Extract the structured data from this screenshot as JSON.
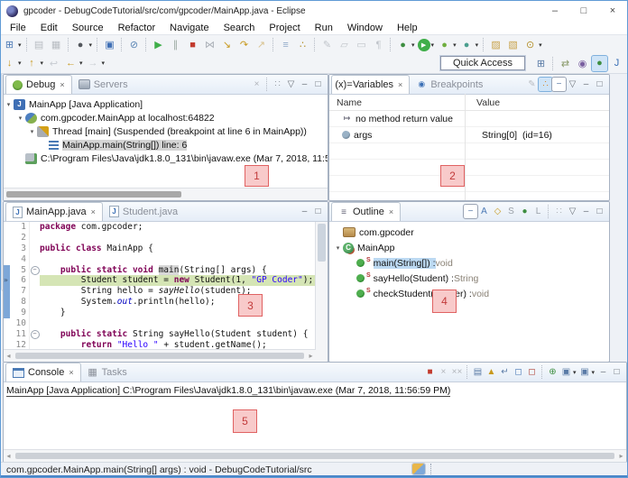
{
  "window": {
    "title": "gpcoder - DebugCodeTutorial/src/com/gpcoder/MainApp.java - Eclipse",
    "controls": {
      "minimize": "–",
      "maximize": "□",
      "close": "×"
    }
  },
  "menu": {
    "items": [
      "File",
      "Edit",
      "Source",
      "Refactor",
      "Navigate",
      "Search",
      "Project",
      "Run",
      "Window",
      "Help"
    ]
  },
  "toolbar": {
    "quick_access": "Quick Access",
    "row1": [
      {
        "n": "new-wizard-icon",
        "g": "⊞",
        "c": "#4a78b5",
        "dd": true
      },
      {
        "sep": true
      },
      {
        "n": "save-icon",
        "g": "▤",
        "c": "#b8bcc2"
      },
      {
        "n": "save-all-icon",
        "g": "▦",
        "c": "#b8bcc2"
      },
      {
        "sep": true
      },
      {
        "n": "user-profile-icon",
        "g": "●",
        "c": "#52565c",
        "dd": true
      },
      {
        "sep": true
      },
      {
        "n": "open-console-view-icon",
        "g": "▣",
        "c": "#3f6fb5"
      },
      {
        "sep": true
      },
      {
        "n": "skip-all-breakpoints-icon",
        "g": "⊘",
        "c": "#5b86b5"
      },
      {
        "sep": true
      },
      {
        "n": "resume-icon",
        "g": "▶",
        "c": "#3fae49"
      },
      {
        "n": "suspend-icon",
        "g": "∥",
        "c": "#9aa8a0"
      },
      {
        "n": "terminate-icon",
        "g": "■",
        "c": "#c23b2e"
      },
      {
        "n": "disconnect-icon",
        "g": "⋈",
        "c": "#a8adb5"
      },
      {
        "n": "step-into-icon",
        "g": "↘",
        "c": "#c8991e"
      },
      {
        "n": "step-over-icon",
        "g": "↷",
        "c": "#c8991e"
      },
      {
        "n": "step-return-icon",
        "g": "↗",
        "c": "#d8c28e"
      },
      {
        "sep": true
      },
      {
        "n": "drop-to-frame-icon",
        "g": "≡",
        "c": "#8fa8c8"
      },
      {
        "n": "use-step-filters-icon",
        "g": "∴",
        "c": "#b5912e"
      },
      {
        "sep": true
      },
      {
        "n": "mark-occurrences-icon",
        "g": "✎",
        "c": "#c0c4ca"
      },
      {
        "n": "show-source-icon",
        "g": "▱",
        "c": "#c0c4ca"
      },
      {
        "n": "show-annotations-icon",
        "g": "▭",
        "c": "#c0c4ca"
      },
      {
        "n": "show-whitespace-icon",
        "g": "¶",
        "c": "#c0c4ca"
      },
      {
        "sep": true
      },
      {
        "n": "debug-icon",
        "g": "●",
        "c": "#3e8e41",
        "dd": true
      },
      {
        "n": "run-icon",
        "g": "▶",
        "c": "#ffffff",
        "bg": "#3fae49",
        "dd": true
      },
      {
        "n": "coverage-icon",
        "g": "●",
        "c": "#6fae3f",
        "dd": true
      },
      {
        "n": "profile-icon",
        "g": "●",
        "c": "#4a9e8e",
        "dd": true
      },
      {
        "sep": true
      },
      {
        "n": "open-type-icon",
        "g": "▨",
        "c": "#c8a24a"
      },
      {
        "n": "open-resource-icon",
        "g": "▧",
        "c": "#c8a24a"
      },
      {
        "n": "search-icon",
        "g": "⊙",
        "c": "#b5912e",
        "dd": true
      }
    ],
    "row2": [
      {
        "n": "next-annotation-icon",
        "g": "↓",
        "c": "#c8991e",
        "dd": true
      },
      {
        "n": "previous-annotation-icon",
        "g": "↑",
        "c": "#c8991e",
        "dd": true
      },
      {
        "n": "last-edit-location-icon",
        "g": "↩",
        "c": "#c8ccd2"
      },
      {
        "n": "back-icon",
        "g": "←",
        "c": "#c8991e",
        "dd": true
      },
      {
        "n": "forward-icon",
        "g": "→",
        "c": "#c8ccd2",
        "dd": true
      }
    ],
    "perspectives": [
      {
        "n": "open-perspective-icon",
        "g": "⊞",
        "c": "#5a7ba6"
      },
      {
        "sep": true
      },
      {
        "n": "team-sync-perspective-icon",
        "g": "⇄",
        "c": "#8a9a6a"
      },
      {
        "n": "java-ee-perspective-icon",
        "g": "◉",
        "c": "#7a5fa0"
      },
      {
        "n": "debug-perspective-icon",
        "g": "●",
        "c": "#3e8e41",
        "active": true
      },
      {
        "n": "java-perspective-icon",
        "g": "J",
        "c": "#3a6fb5"
      }
    ]
  },
  "debug_view": {
    "tabs": [
      {
        "label": "Debug",
        "icon": "bug",
        "ig": "",
        "name": "tab-debug",
        "selected": true,
        "close": true
      },
      {
        "label": "Servers",
        "icon": "server",
        "ig": "",
        "name": "tab-servers"
      }
    ],
    "toolbar": [
      {
        "n": "remove-all-terminated-icon",
        "g": "×",
        "c": "#b0b4ba"
      },
      {
        "sep": true
      },
      {
        "n": "view-options-icon",
        "g": "∷",
        "c": "#9aa0a8"
      },
      {
        "n": "view-menu-icon",
        "g": "▽",
        "c": "#6a7078"
      },
      {
        "n": "minimize-view-icon",
        "g": "–",
        "c": "#6a7078"
      },
      {
        "n": "maximize-view-icon",
        "g": "□",
        "c": "#6a7078"
      }
    ],
    "tree": [
      {
        "level": 0,
        "exp": true,
        "icon": "javaapp",
        "iglyph": "J",
        "text": "MainApp [Java Application]"
      },
      {
        "level": 1,
        "exp": true,
        "icon": "jvm",
        "iglyph": "",
        "text": "com.gpcoder.MainApp at localhost:64822"
      },
      {
        "level": 2,
        "exp": true,
        "icon": "thread",
        "iglyph": "",
        "text": "Thread [main] (Suspended (breakpoint at line 6 in MainApp))"
      },
      {
        "level": 3,
        "icon": "frame",
        "iglyph": "",
        "text": "MainApp.main(String[]) line: 6",
        "selected": true
      },
      {
        "level": 1,
        "icon": "process",
        "iglyph": "",
        "text": "C:\\Program Files\\Java\\jdk1.8.0_131\\bin\\javaw.exe (Mar 7, 2018, 11:56:59 PM)"
      }
    ]
  },
  "variables_view": {
    "tabs": [
      {
        "label": "Variables",
        "icon": "vars",
        "ig": "(x)=",
        "name": "tab-variables",
        "selected": true,
        "close": true
      },
      {
        "label": "Breakpoints",
        "icon": "bp",
        "ig": "◉",
        "name": "tab-breakpoints"
      }
    ],
    "toolbar": [
      {
        "n": "show-type-names-icon",
        "g": "✎",
        "c": "#b8bcc2"
      },
      {
        "n": "show-logical-structures-icon",
        "g": "∴",
        "c": "#d8862e",
        "active": true
      },
      {
        "n": "collapse-all-icon",
        "g": "−",
        "c": "#5a7ba6",
        "b": true
      },
      {
        "n": "view-menu-icon",
        "g": "▽",
        "c": "#6a7078"
      },
      {
        "n": "minimize-view-icon",
        "g": "–",
        "c": "#6a7078"
      },
      {
        "n": "maximize-view-icon",
        "g": "□",
        "c": "#6a7078"
      }
    ],
    "columns": [
      "Name",
      "Value"
    ],
    "rows": [
      {
        "icon": "ret",
        "iglyph": "↦",
        "name": "no method return value",
        "value": ""
      },
      {
        "icon": "var",
        "iglyph": "",
        "name": "args",
        "value": "String[0]  (id=16)"
      }
    ]
  },
  "editor": {
    "tabs": [
      {
        "label": "MainApp.java",
        "icon": "jfile",
        "ig": "J",
        "name": "tab-mainapp-java",
        "selected": true,
        "close": true
      },
      {
        "label": "Student.java",
        "icon": "jfile",
        "ig": "J",
        "name": "tab-student-java"
      }
    ],
    "toolbar": [
      {
        "n": "minimize-view-icon",
        "g": "–",
        "c": "#6a7078"
      },
      {
        "n": "maximize-view-icon",
        "g": "□",
        "c": "#6a7078"
      }
    ],
    "lines": [
      {
        "n": "1",
        "tokens": [
          {
            "s": "package",
            "c": "kw"
          },
          {
            "s": " com.gpcoder;",
            "c": "pl"
          }
        ]
      },
      {
        "n": "2",
        "tokens": []
      },
      {
        "n": "3",
        "tokens": [
          {
            "s": "public class",
            "c": "kw"
          },
          {
            "s": " MainApp {",
            "c": "pl"
          }
        ]
      },
      {
        "n": "4",
        "tokens": []
      },
      {
        "n": "5",
        "fold": true,
        "range": true,
        "tokens": [
          {
            "s": "    ",
            "c": "pl"
          },
          {
            "s": "public static void",
            "c": "kw"
          },
          {
            "s": " ",
            "c": "pl"
          },
          {
            "s": "main",
            "c": "occ"
          },
          {
            "s": "(String[] args) {",
            "c": "pl"
          }
        ]
      },
      {
        "n": "6",
        "range": true,
        "current": true,
        "ptr": true,
        "tokens": [
          {
            "s": "        Student student = ",
            "c": "pl"
          },
          {
            "s": "new",
            "c": "kw"
          },
          {
            "s": " Student(1, ",
            "c": "pl"
          },
          {
            "s": "\"GP Coder\"",
            "c": "str"
          },
          {
            "s": ");",
            "c": "pl"
          }
        ]
      },
      {
        "n": "7",
        "range": true,
        "tokens": [
          {
            "s": "        String hello = ",
            "c": "pl"
          },
          {
            "s": "sayHello",
            "c": "sm"
          },
          {
            "s": "(student);",
            "c": "pl"
          }
        ]
      },
      {
        "n": "8",
        "range": true,
        "tokens": [
          {
            "s": "        System.",
            "c": "pl"
          },
          {
            "s": "out",
            "c": "sf"
          },
          {
            "s": ".println(hello);",
            "c": "pl"
          }
        ]
      },
      {
        "n": "9",
        "range": true,
        "tokens": [
          {
            "s": "    }",
            "c": "pl"
          }
        ]
      },
      {
        "n": "10",
        "tokens": []
      },
      {
        "n": "11",
        "fold": true,
        "tokens": [
          {
            "s": "    ",
            "c": "pl"
          },
          {
            "s": "public static",
            "c": "kw"
          },
          {
            "s": " String sayHello(Student student) {",
            "c": "pl"
          }
        ]
      },
      {
        "n": "12",
        "tokens": [
          {
            "s": "        ",
            "c": "pl"
          },
          {
            "s": "return",
            "c": "kw"
          },
          {
            "s": " ",
            "c": "pl"
          },
          {
            "s": "\"Hello \"",
            "c": "str"
          },
          {
            "s": " + student.getName();",
            "c": "pl"
          }
        ]
      }
    ]
  },
  "outline_view": {
    "tabs": [
      {
        "label": "Outline",
        "icon": "outline",
        "ig": "≡",
        "name": "tab-outline",
        "selected": true,
        "close": true
      }
    ],
    "toolbar": [
      {
        "n": "collapse-all-icon",
        "g": "−",
        "c": "#5a7ba6",
        "b": true
      },
      {
        "n": "sort-icon",
        "g": "A",
        "c": "#4a78b5"
      },
      {
        "n": "hide-fields-icon",
        "g": "◇",
        "c": "#c8991e"
      },
      {
        "n": "hide-static-members-icon",
        "g": "S",
        "c": "#9aa0a8"
      },
      {
        "n": "hide-non-public-icon",
        "g": "●",
        "c": "#3e8e41"
      },
      {
        "n": "hide-local-types-icon",
        "g": "L",
        "c": "#9aa0a8"
      },
      {
        "sep": true
      },
      {
        "n": "link-with-editor-icon",
        "g": "∷",
        "c": "#b0b4ba"
      },
      {
        "n": "view-menu-icon",
        "g": "▽",
        "c": "#6a7078"
      },
      {
        "n": "minimize-view-icon",
        "g": "–",
        "c": "#6a7078"
      },
      {
        "n": "maximize-view-icon",
        "g": "□",
        "c": "#6a7078"
      }
    ],
    "tree": [
      {
        "level": 1,
        "icon": "pkg",
        "sup": "",
        "name": "com.gpcoder",
        "type": ""
      },
      {
        "level": 0,
        "exp": true,
        "icon": "cls",
        "iglyph": "C",
        "sup": "",
        "name": "MainApp",
        "type": ""
      },
      {
        "level": 2,
        "icon": "met",
        "sup": "S",
        "name": "main(String[])",
        "type": "void",
        "selected": true
      },
      {
        "level": 2,
        "icon": "met",
        "sup": "S",
        "name": "sayHello(Student)",
        "type": "String"
      },
      {
        "level": 2,
        "icon": "met",
        "sup": "S",
        "name": "checkStudent(Integer)",
        "type": "void"
      }
    ]
  },
  "console_view": {
    "tabs": [
      {
        "label": "Console",
        "icon": "console",
        "ig": "",
        "name": "tab-console",
        "selected": true,
        "close": true
      },
      {
        "label": "Tasks",
        "icon": "tasks",
        "ig": "▦",
        "name": "tab-tasks"
      }
    ],
    "toolbar": [
      {
        "n": "terminate-icon",
        "g": "■",
        "c": "#c23b2e"
      },
      {
        "n": "remove-launch-icon",
        "g": "×",
        "c": "#b0b4ba"
      },
      {
        "n": "remove-all-launches-icon",
        "g": "××",
        "c": "#b0b4ba"
      },
      {
        "sep": true
      },
      {
        "n": "clear-console-icon",
        "g": "▤",
        "c": "#5a7ba6"
      },
      {
        "n": "scroll-lock-icon",
        "g": "▲",
        "c": "#c8991e"
      },
      {
        "n": "word-wrap-icon",
        "g": "↵",
        "c": "#5a7ba6"
      },
      {
        "n": "show-stdout-icon",
        "g": "◻",
        "c": "#4a78b5"
      },
      {
        "n": "show-stderr-icon",
        "g": "◻",
        "c": "#b04438"
      },
      {
        "sep": true
      },
      {
        "n": "pin-console-icon",
        "g": "⊕",
        "c": "#3e8e41"
      },
      {
        "n": "display-console-icon",
        "g": "▣",
        "c": "#5a7ba6",
        "dd": true
      },
      {
        "n": "open-console-icon",
        "g": "▣",
        "c": "#5a7ba6",
        "dd": true
      },
      {
        "n": "minimize-view-icon",
        "g": "–",
        "c": "#6a7078"
      },
      {
        "n": "maximize-view-icon",
        "g": "□",
        "c": "#6a7078"
      }
    ],
    "text": "MainApp [Java Application] C:\\Program Files\\Java\\jdk1.8.0_131\\bin\\javaw.exe (Mar 7, 2018, 11:56:59 PM)"
  },
  "status_bar": {
    "text": "com.gpcoder.MainApp.main(String[] args) : void - DebugCodeTutorial/src"
  },
  "side_strip": {
    "items": [
      {
        "n": "drag-handle-icon",
        "g": "⋯",
        "c": "#9aa0a8"
      },
      {
        "n": "restore-views-icon",
        "g": "▣",
        "c": "#5a7ba6"
      },
      {
        "n": "help-contents-icon",
        "g": "?",
        "c": "#4a78b5"
      },
      {
        "n": "minimized-editor-icon",
        "g": "▤",
        "c": "#8a94a8"
      },
      {
        "n": "minimized-view-icon",
        "g": "▥",
        "c": "#8a94a8"
      }
    ]
  },
  "annotations": [
    {
      "label": "1"
    },
    {
      "label": "2"
    },
    {
      "label": "3"
    },
    {
      "label": "4"
    },
    {
      "label": "5"
    }
  ],
  "ui": {
    "dd": "▾",
    "fold": "−",
    "ptr": "»",
    "close": "×",
    "exp": "▾",
    "scroll_left": "◂",
    "scroll_right": "▸",
    "type_sep": " : "
  }
}
